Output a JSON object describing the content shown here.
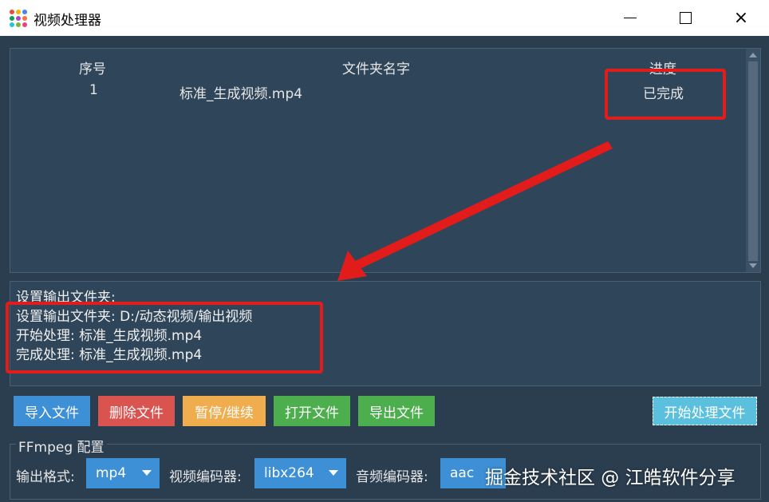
{
  "window": {
    "title": "视频处理器",
    "icon": "app-dots-icon",
    "minimize": "minimize-icon",
    "maximize": "maximize-icon",
    "close": "×"
  },
  "table": {
    "headers": [
      "序号",
      "文件夹名字",
      "进度"
    ],
    "rows": [
      {
        "index": "1",
        "name": "标准_生成视频.mp4",
        "progress": "已完成"
      }
    ]
  },
  "log": {
    "lines": [
      "设置输出文件夹:",
      "设置输出文件夹: D:/动态视频/输出视频",
      "开始处理: 标准_生成视频.mp4",
      "完成处理: 标准_生成视频.mp4"
    ]
  },
  "buttons": {
    "import": "导入文件",
    "delete": "删除文件",
    "pause": "暂停/继续",
    "open": "打开文件",
    "export": "导出文件",
    "start": "开始处理文件"
  },
  "ffmpeg": {
    "group_title": "FFmpeg 配置",
    "format_label": "输出格式:",
    "format_value": "mp4",
    "video_label": "视频编码器:",
    "video_value": "libx264",
    "audio_label": "音频编码器:",
    "audio_value": "aac"
  },
  "watermark": "掘金技术社区 @ 江皓软件分享",
  "colors": {
    "background": "#2b3e50",
    "primary": "#3d8fd6",
    "danger": "#d9534f",
    "warning": "#f0ad4e",
    "success": "#4cae4c",
    "info": "#5bc0de",
    "annotation": "#e21b1b"
  }
}
